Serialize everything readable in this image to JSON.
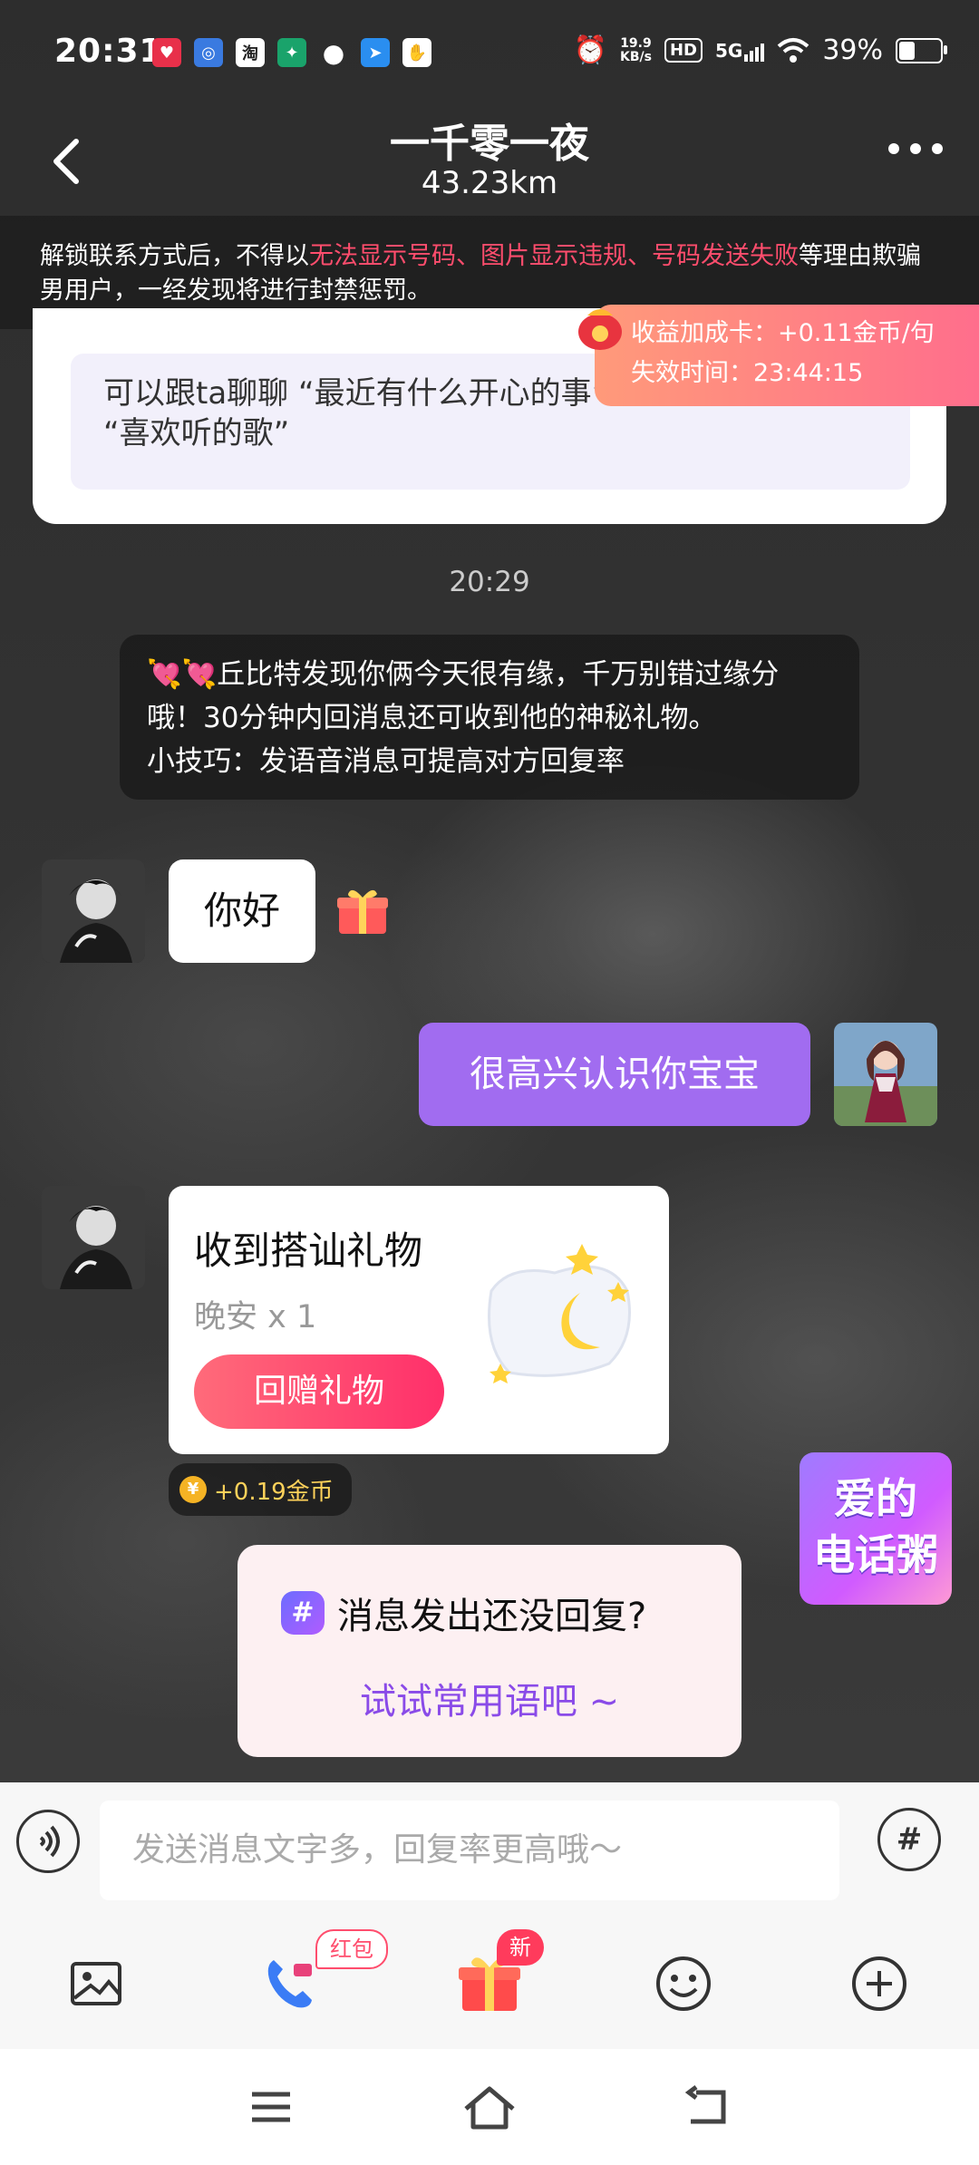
{
  "status_bar": {
    "time": "20:31",
    "app_icons": [
      "app-icon-1",
      "app-icon-2",
      "taobao-icon",
      "app-icon-4",
      "chat-icon",
      "app-icon-6",
      "app-icon-7"
    ],
    "speed_value": "19.9",
    "speed_unit": "KB/s",
    "hd": "HD",
    "network": "5G",
    "battery": "39%",
    "battery_level": 0.39
  },
  "header": {
    "title": "一千零一夜",
    "distance": "43.23km"
  },
  "notice": {
    "prefix": "解锁联系方式后，不得以",
    "highlight": "无法显示号码、图片显示违规、号码发送失败",
    "suffix": "等理由欺骗男用户，一经发现将进行封禁惩罚。"
  },
  "suggest": {
    "text": "可以跟ta聊聊 “最近有什么开心的事” “喜欢吃什么菜” “喜欢听的歌”"
  },
  "bonus": {
    "line1": "收益加成卡：+0.11金币/句",
    "line2": "失效时间：23:44:15"
  },
  "timestamp": "20:29",
  "system_message": {
    "emoji": "💘💘",
    "text": "丘比特发现你俩今天很有缘，千万别错过缘分哦！30分钟内回消息还可收到他的神秘礼物。",
    "tip": "小技巧：发语音消息可提高对方回复率"
  },
  "messages": [
    {
      "side": "left",
      "text": "你好"
    },
    {
      "side": "right",
      "text": "很高兴认识你宝宝"
    }
  ],
  "gift_card": {
    "title": "收到搭讪礼物",
    "item": "晚安 x 1",
    "button": "回赠礼物",
    "coin_text": "+0.19金币"
  },
  "promo": {
    "line1": "爱的",
    "line2": "电话粥"
  },
  "hint": {
    "title": "消息发出还没回复?",
    "link": "试试常用语吧 ~"
  },
  "input": {
    "placeholder": "发送消息文字多，回复率更高哦～"
  },
  "toolbar": {
    "call_badge": "红包",
    "gift_badge": "新"
  },
  "colors": {
    "accent_purple": "#a16cf0",
    "notice_red": "#ff4d6d",
    "button_pink": "#ff2f6a"
  }
}
